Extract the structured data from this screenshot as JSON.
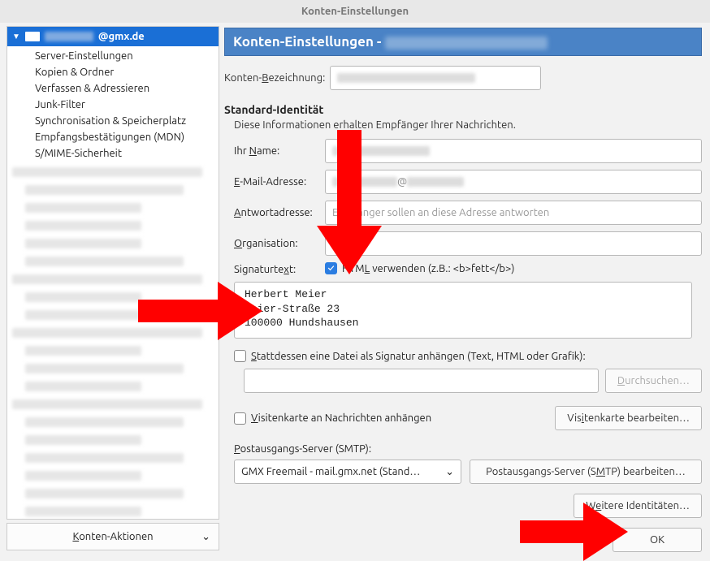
{
  "window": {
    "title": "Konten-Einstellungen"
  },
  "sidebar": {
    "root_account": "@gmx.de",
    "items": [
      "Server-Einstellungen",
      "Kopien & Ordner",
      "Verfassen & Adressieren",
      "Junk-Filter",
      "Synchronisation & Speicherplatz",
      "Empfangsbestätigungen (MDN)",
      "S/MIME-Sicherheit"
    ],
    "actions_label": "Konten-Aktionen"
  },
  "header": {
    "prefix": "Konten-Einstellungen - "
  },
  "account_name": {
    "label": "Konten-Bezeichnung:"
  },
  "identity": {
    "section_title": "Standard-Identität",
    "section_desc": "Diese Informationen erhalten Empfänger Ihrer Nachrichten.",
    "name_label": "Ihr Name:",
    "email_label": "E-Mail-Adresse:",
    "reply_label": "Antwortadresse:",
    "reply_placeholder": "Empfänger sollen an diese Adresse antworten",
    "org_label": "Organisation:"
  },
  "signature": {
    "label": "Signaturtext:",
    "html_label": "HTML verwenden (z.B.: <b>fett</b>)",
    "text": "Herbert Meier\nMeier-Straße 23\n100000 Hundshausen",
    "file_label": "Stattdessen eine Datei als Signatur anhängen (Text, HTML oder Grafik):",
    "browse_label": "Durchsuchen…",
    "vcard_label": "Visitenkarte an Nachrichten anhängen",
    "vcard_edit_label": "Visitenkarte bearbeiten…"
  },
  "smtp": {
    "label": "Postausgangs-Server (SMTP):",
    "selected": "GMX Freemail - mail.gmx.net (Stand…",
    "edit_label": "Postausgangs-Server (SMTP) bearbeiten…"
  },
  "more_identities_label": "Weitere Identitäten…",
  "ok_label": "OK"
}
